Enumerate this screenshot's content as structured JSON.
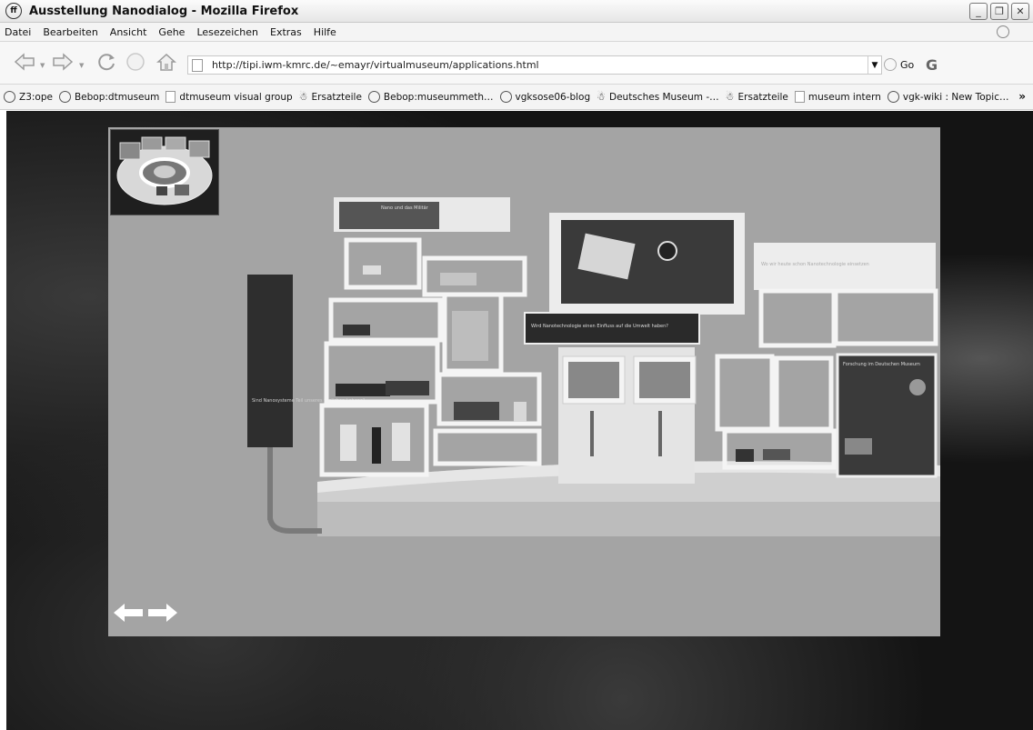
{
  "window": {
    "title": "Ausstellung Nanodialog - Mozilla Firefox"
  },
  "menu": {
    "items": [
      "Datei",
      "Bearbeiten",
      "Ansicht",
      "Gehe",
      "Lesezeichen",
      "Extras",
      "Hilfe"
    ]
  },
  "toolbar": {
    "url": "http://tipi.iwm-kmrc.de/~emayr/virtualmuseum/applications.html",
    "go_label": "Go"
  },
  "bookmarks": [
    {
      "label": "Z3:ope",
      "icon": "globe-icon"
    },
    {
      "label": "Bebop:dtmuseum",
      "icon": "globe-icon"
    },
    {
      "label": "dtmuseum visual group",
      "icon": "page-icon"
    },
    {
      "label": "Ersatzteile",
      "icon": "bug-icon"
    },
    {
      "label": "Bebop:museummeth…",
      "icon": "globe-icon"
    },
    {
      "label": "vgksose06-blog",
      "icon": "globe-icon"
    },
    {
      "label": "Deutsches Museum -…",
      "icon": "bug-icon"
    },
    {
      "label": "Ersatzteile",
      "icon": "bug-icon"
    },
    {
      "label": "museum intern",
      "icon": "page-icon"
    },
    {
      "label": "vgk-wiki : New Topic…",
      "icon": "globe-icon"
    }
  ],
  "bookmarks_more": "»",
  "exhibit": {
    "panel_left": "Sind Nanosysteme Teil unseres täglichen Lebens?",
    "panel_top": "Nano und das Militär",
    "panel_center": "Wird Nanotechnologie einen Einfluss auf die Umwelt haben?",
    "panel_right_top": "Wo wir heute schon Nanotechnologie einsetzen",
    "panel_right": "Forschung im Deutschen Museum"
  },
  "colors": {
    "viewer_bg": "#a4a4a4",
    "page_bg": "#141414"
  }
}
